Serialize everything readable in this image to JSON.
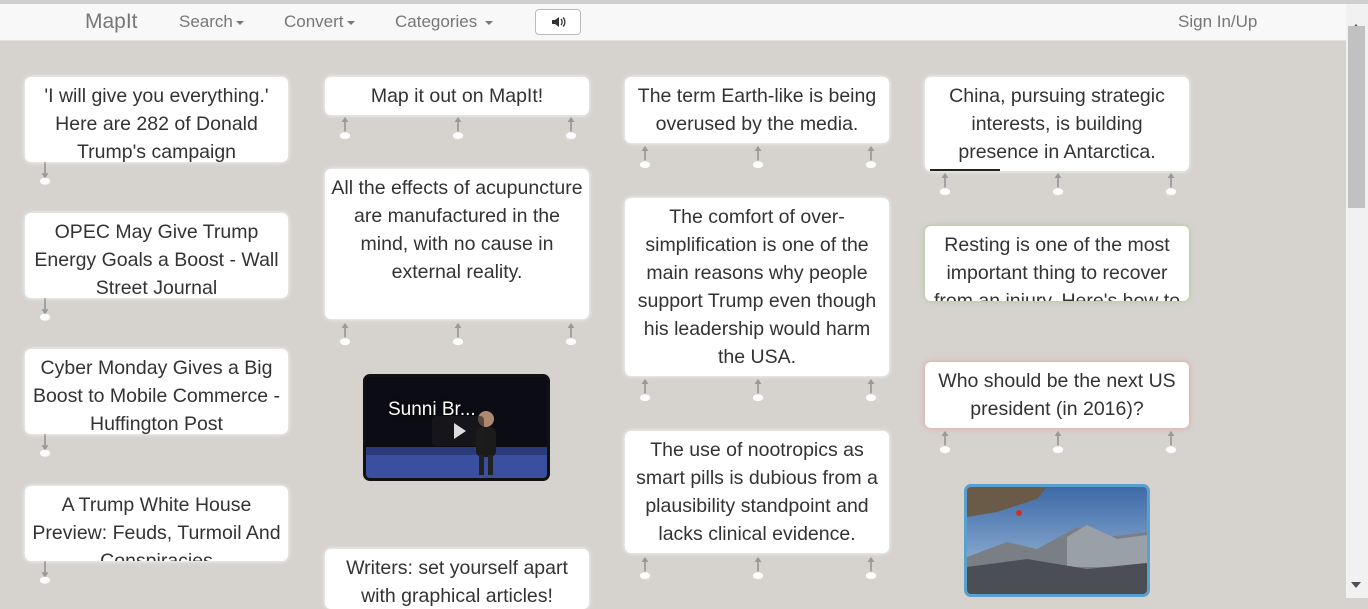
{
  "nav": {
    "brand": "MapIt",
    "search": "Search",
    "convert": "Convert",
    "categories": "Categories",
    "signin": "Sign In/Up",
    "sound_icon": "volume-icon"
  },
  "cards": [
    {
      "id": "c1",
      "text": "'I will give you everything.' Here are 282 of Donald Trump's campaign"
    },
    {
      "id": "c2",
      "text": "OPEC May Give Trump Energy Goals a Boost - Wall Street Journal"
    },
    {
      "id": "c3",
      "text": "Cyber Monday Gives a Big Boost to Mobile Commerce - Huffington Post"
    },
    {
      "id": "c4",
      "text": "A Trump White House Preview: Feuds, Turmoil And Conspiracies"
    },
    {
      "id": "c5",
      "text": "Map it out on MapIt!"
    },
    {
      "id": "c6",
      "text": "All the effects of acupuncture are manufactured in the mind, with no cause in external reality."
    },
    {
      "id": "c7",
      "text": "Writers: set yourself apart with graphical articles!"
    },
    {
      "id": "c8",
      "text": "The term Earth-like is being overused by the media."
    },
    {
      "id": "c9",
      "text": "The comfort of over-simplification is one of the main reasons why people support Trump even though his leadership would harm the USA."
    },
    {
      "id": "c10",
      "text": "The use of nootropics as smart pills is dubious from a plausibility standpoint and lacks clinical evidence."
    },
    {
      "id": "c11",
      "text": "China, pursuing strategic interests, is building presence in Antarctica."
    },
    {
      "id": "c12",
      "text": "Resting is one of the most important thing to recover from an injury. Here's how to"
    },
    {
      "id": "c13",
      "text": "Who should be the next US president (in 2016)?"
    }
  ],
  "video": {
    "title": "Sunni Br...",
    "icon": "play-icon"
  },
  "photo": {
    "icon": "mountain-photo"
  }
}
